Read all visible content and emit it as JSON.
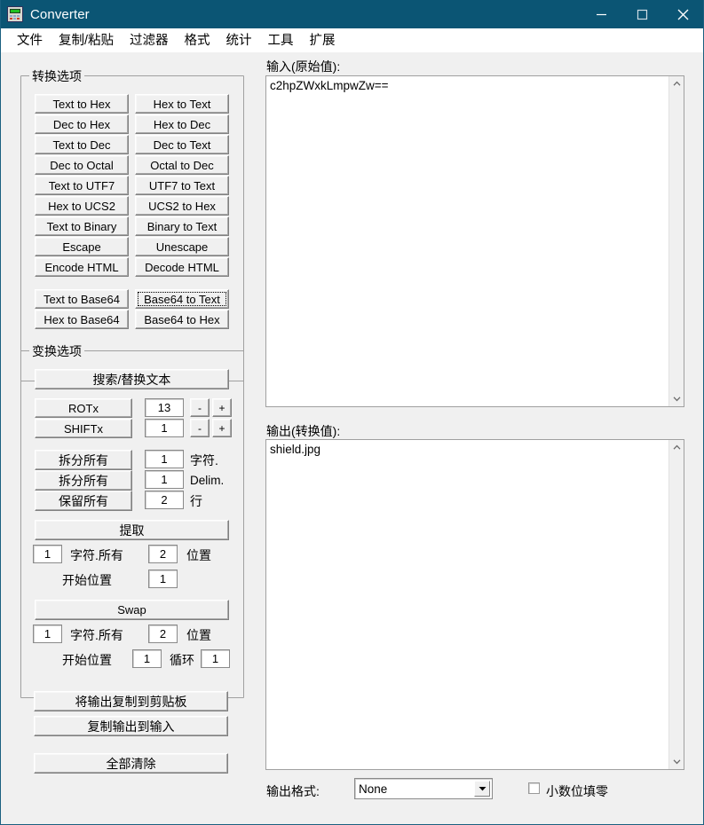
{
  "window": {
    "title": "Converter",
    "icon": "calculator-icon",
    "accent_color": "#0b5574",
    "background_color": "#f0f0f0",
    "minimize_label": "—",
    "maximize_label": "□",
    "close_label": "✕"
  },
  "menubar": {
    "items": [
      {
        "label": "文件"
      },
      {
        "label": "复制/粘贴"
      },
      {
        "label": "过滤器"
      },
      {
        "label": "格式"
      },
      {
        "label": "统计"
      },
      {
        "label": "工具"
      },
      {
        "label": "扩展"
      }
    ]
  },
  "conversion_options": {
    "title": "转换选项",
    "rows": [
      {
        "left": "Text to Hex",
        "right": "Hex to Text"
      },
      {
        "left": "Dec to Hex",
        "right": "Hex to Dec"
      },
      {
        "left": "Text to Dec",
        "right": "Dec to Text"
      },
      {
        "left": "Dec to Octal",
        "right": "Octal to Dec"
      },
      {
        "left": "Text to UTF7",
        "right": "UTF7 to Text"
      },
      {
        "left": "Hex to UCS2",
        "right": "UCS2 to Hex"
      },
      {
        "left": "Text to Binary",
        "right": "Binary to Text"
      },
      {
        "left": "Escape",
        "right": "Unescape"
      },
      {
        "left": "Encode HTML",
        "right": "Decode HTML"
      }
    ],
    "base64_rows": [
      {
        "left": "Text to Base64",
        "right": "Base64 to Text"
      },
      {
        "left": "Hex to Base64",
        "right": "Base64 to Hex"
      }
    ],
    "focused_button": "Base64 to Text"
  },
  "transform_options": {
    "title": "变换选项",
    "search_replace_label": "搜索/替换文本",
    "rot": {
      "label": "ROTx",
      "value": "13",
      "minus": "-",
      "plus": "+"
    },
    "shift": {
      "label": "SHIFTx",
      "value": "1",
      "minus": "-",
      "plus": "+"
    },
    "split_chars": {
      "label": "拆分所有",
      "value": "1",
      "unit": "字符."
    },
    "split_delim": {
      "label": "拆分所有",
      "value": "1",
      "unit": "Delim."
    },
    "keep_lines": {
      "label": "保留所有",
      "value": "2",
      "unit": "行"
    },
    "extract": {
      "button": "提取",
      "chars_value": "1",
      "chars_label": "字符.所有",
      "pos_value": "2",
      "pos_label": "位置",
      "start_label": "开始位置",
      "start_value": "1"
    },
    "swap": {
      "button": "Swap",
      "chars_value": "1",
      "chars_label": "字符.所有",
      "pos_value": "2",
      "pos_label": "位置",
      "start_label": "开始位置",
      "start_value": "1",
      "loop_label": "循环",
      "loop_value": "1"
    }
  },
  "actions": {
    "copy_output_clipboard": "将输出复制到剪贴板",
    "copy_output_to_input": "复制输出到输入",
    "clear_all": "全部清除"
  },
  "input_panel": {
    "label": "输入(原始值):",
    "value": "c2hpZWxkLmpwZw==",
    "scroll_up_icon": "chevron-up-icon",
    "scroll_down_icon": "chevron-down-icon"
  },
  "output_panel": {
    "label": "输出(转换值):",
    "value": "shield.jpg",
    "scroll_up_icon": "chevron-up-icon",
    "scroll_down_icon": "chevron-down-icon"
  },
  "footer": {
    "format_label": "输出格式:",
    "format_value": "None",
    "pad_decimals_label": "小数位填零",
    "pad_decimals_checked": false
  }
}
